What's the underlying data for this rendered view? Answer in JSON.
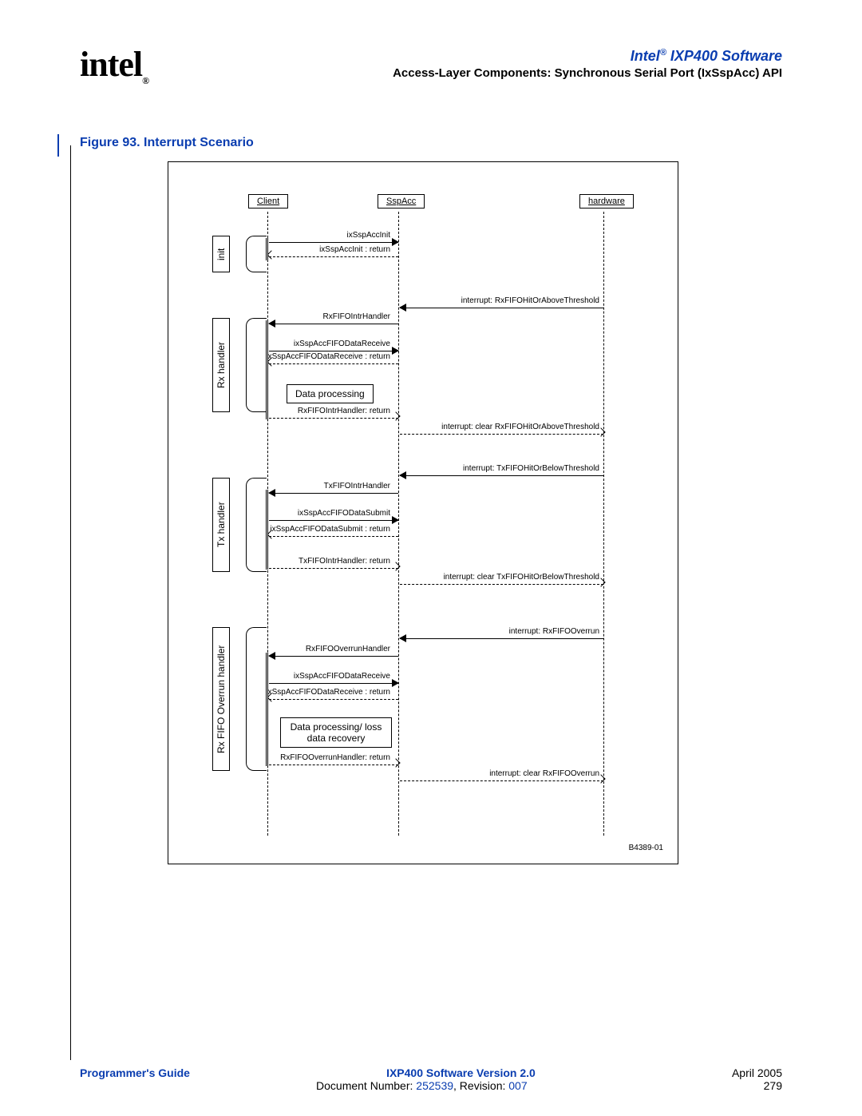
{
  "header": {
    "product_prefix": "Intel",
    "product_reg": "®",
    "product_suffix": " IXP400 Software",
    "section": "Access-Layer Components: Synchronous Serial Port (IxSspAcc) API"
  },
  "logo": {
    "text": "intel",
    "reg": "®"
  },
  "figure": {
    "caption": "Figure 93. Interrupt Scenario",
    "id": "B4389-01",
    "lifelines": {
      "client": "Client",
      "sspacc": "SspAcc",
      "hardware": "hardware"
    },
    "phases": {
      "init": "init",
      "rxh": "Rx handler",
      "txh": "Tx handler",
      "rxov": "Rx FIFO Overrun handler"
    },
    "notes": {
      "dp": "Data processing",
      "dprec": "Data processing/ loss data recovery"
    },
    "msgs": {
      "m1": "ixSspAccInit",
      "m2": "ixSspAccInit : return",
      "m3": "interrupt: RxFIFOHitOrAboveThreshold",
      "m4": "RxFIFOIntrHandler",
      "m5": "ixSspAccFIFODataReceive",
      "m6": "ixSspAccFIFODataReceive : return",
      "m7": "RxFIFOIntrHandler: return",
      "m8": "interrupt: clear RxFIFOHitOrAboveThreshold",
      "m9": "interrupt: TxFIFOHitOrBelowThreshold",
      "m10": "TxFIFOIntrHandler",
      "m11": "ixSspAccFIFODataSubmit",
      "m12": "ixSspAccFIFODataSubmit : return",
      "m13": "TxFIFOIntrHandler: return",
      "m14": "interrupt: clear TxFIFOHitOrBelowThreshold",
      "m15": "interrupt: RxFIFOOverrun",
      "m16": "RxFIFOOverrunHandler",
      "m17": "ixSspAccFIFODataReceive",
      "m18": "ixSspAccFIFODataReceive : return",
      "m19": "RxFIFOOverrunHandler: return",
      "m20": "interrupt: clear RxFIFOOverrun"
    }
  },
  "footer": {
    "guide": "Programmer's Guide",
    "version": "IXP400 Software Version 2.0",
    "date": "April 2005",
    "docnum_label": "Document Number: ",
    "docnum": "252539",
    "rev_label": ", Revision: ",
    "rev": "007",
    "page": "279"
  }
}
